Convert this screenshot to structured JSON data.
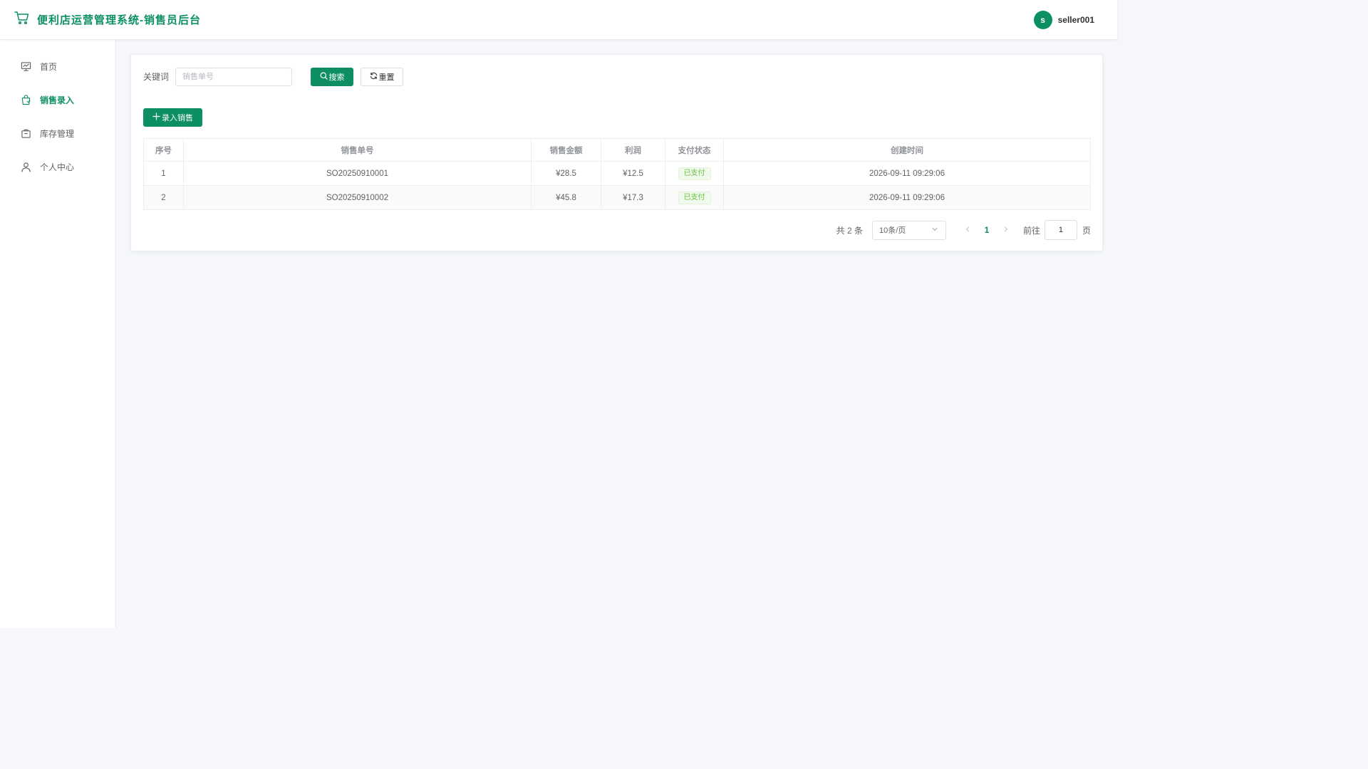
{
  "app": {
    "title": "便利店运营管理系统-销售员后台",
    "brand_icon": "shopping-cart-icon",
    "accent_color": "#0e8f63"
  },
  "user": {
    "avatar_letter": "s",
    "name": "seller001"
  },
  "sidebar": {
    "items": [
      {
        "label": "首页",
        "icon": "dashboard-icon",
        "active": false
      },
      {
        "label": "销售录入",
        "icon": "shopping-bag-icon",
        "active": true
      },
      {
        "label": "库存管理",
        "icon": "box-icon",
        "active": false
      },
      {
        "label": "个人中心",
        "icon": "user-icon",
        "active": false
      }
    ]
  },
  "filter": {
    "keyword_label": "关键词",
    "keyword_value": "",
    "keyword_placeholder": "销售单号",
    "search_label": "搜索",
    "reset_label": "重置"
  },
  "toolbar": {
    "add_label": "录入销售"
  },
  "table": {
    "columns": [
      "序号",
      "销售单号",
      "销售金额",
      "利润",
      "支付状态",
      "创建时间"
    ],
    "rows": [
      {
        "index": "1",
        "order_no": "SO20250910001",
        "amount": "¥28.5",
        "profit": "¥12.5",
        "status": "已支付",
        "created": "2026-09-11 09:29:06"
      },
      {
        "index": "2",
        "order_no": "SO20250910002",
        "amount": "¥45.8",
        "profit": "¥17.3",
        "status": "已支付",
        "created": "2026-09-11 09:29:06"
      }
    ]
  },
  "pagination": {
    "total_text": "共 2 条",
    "page_size": "10条/页",
    "current_page": "1",
    "goto_label": "前往",
    "goto_value": "1",
    "page_suffix": "页"
  }
}
